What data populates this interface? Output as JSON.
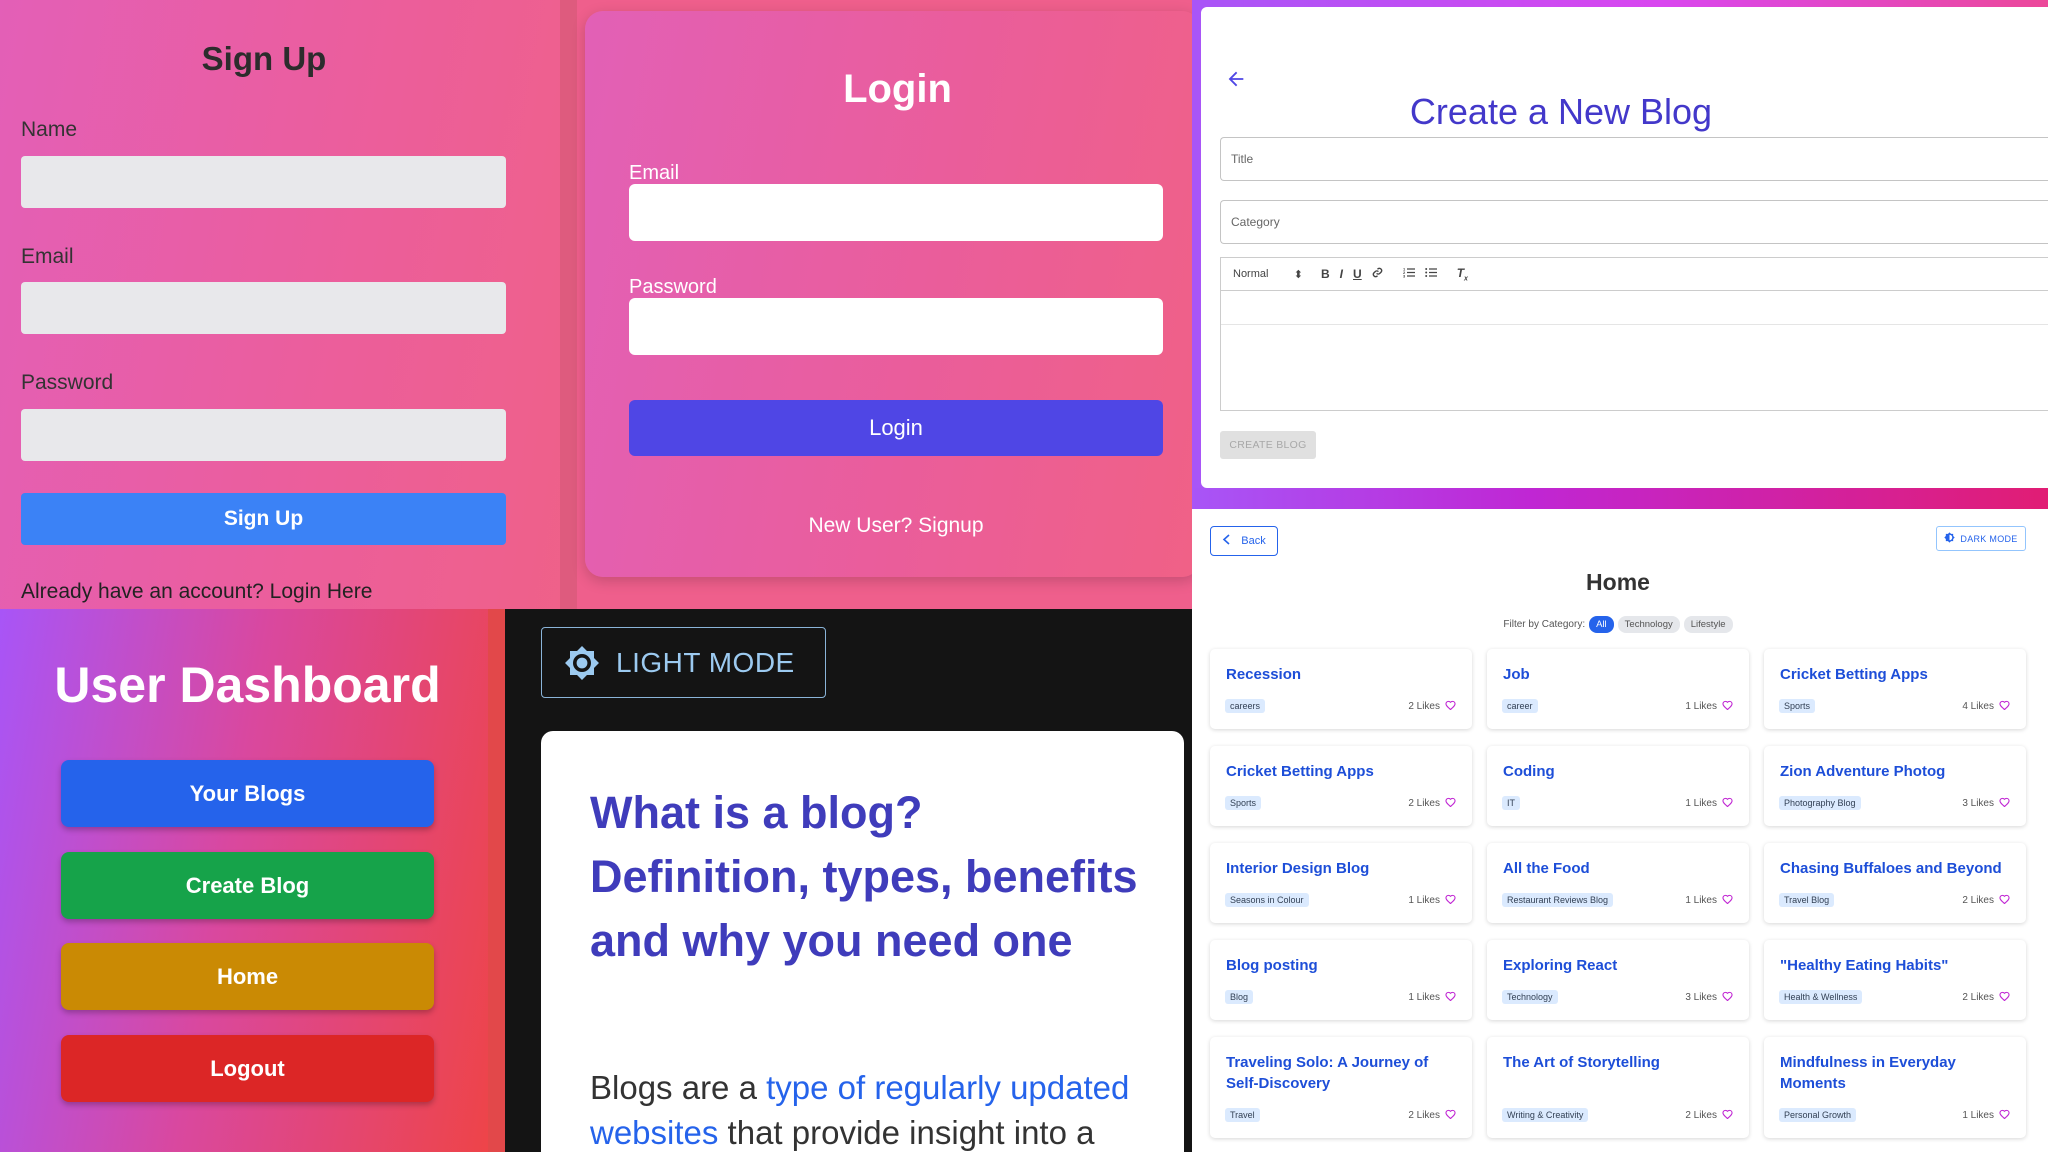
{
  "signup": {
    "title": "Sign Up",
    "name_label": "Name",
    "email_label": "Email",
    "password_label": "Password",
    "button": "Sign Up",
    "footer": "Already have an account? Login Here"
  },
  "login": {
    "title": "Login",
    "email_label": "Email",
    "password_label": "Password",
    "button": "Login",
    "footer": "New User? Signup"
  },
  "create_blog": {
    "title": "Create a New Blog",
    "title_placeholder": "Title",
    "category_placeholder": "Category",
    "format_select": "Normal",
    "button": "CREATE BLOG",
    "colors": {
      "heading": "#4338ca",
      "back": "#4f46e5"
    }
  },
  "dashboard": {
    "title": "User Dashboard",
    "buttons": [
      {
        "label": "Your Blogs",
        "color": "#2563eb"
      },
      {
        "label": "Create Blog",
        "color": "#16a34a"
      },
      {
        "label": "Home",
        "color": "#ca8a04"
      },
      {
        "label": "Logout",
        "color": "#dc2626"
      }
    ]
  },
  "article": {
    "mode_button": "LIGHT MODE",
    "heading": "What is a blog? Definition, types, benefits and why you need one",
    "body_start": "Blogs are a ",
    "body_link": "type of regularly updated websites",
    "body_end": " that provide insight into a"
  },
  "home": {
    "back": "Back",
    "dark_mode": "DARK MODE",
    "title": "Home",
    "filter_label": "Filter by Category:",
    "filters": [
      "All",
      "Technology",
      "Lifestyle"
    ],
    "active_filter": "All",
    "blogs": [
      {
        "title": "Recession",
        "category": "careers",
        "likes": "2 Likes"
      },
      {
        "title": "Job",
        "category": "career",
        "likes": "1 Likes"
      },
      {
        "title": "Cricket Betting Apps",
        "category": "Sports",
        "likes": "4 Likes"
      },
      {
        "title": "Cricket Betting Apps",
        "category": "Sports",
        "likes": "2 Likes"
      },
      {
        "title": "Coding",
        "category": "IT",
        "likes": "1 Likes"
      },
      {
        "title": "Zion Adventure Photog",
        "category": "Photography Blog",
        "likes": "3 Likes"
      },
      {
        "title": "Interior Design Blog",
        "category": "Seasons in Colour",
        "likes": "1 Likes"
      },
      {
        "title": "All the Food",
        "category": "Restaurant Reviews Blog",
        "likes": "1 Likes"
      },
      {
        "title": "Chasing Buffaloes and Beyond",
        "category": "Travel Blog",
        "likes": "2 Likes"
      },
      {
        "title": "Blog posting",
        "category": "Blog",
        "likes": "1 Likes"
      },
      {
        "title": "Exploring React",
        "category": "Technology",
        "likes": "3 Likes"
      },
      {
        "title": "\"Healthy Eating Habits\"",
        "category": "Health & Wellness",
        "likes": "2 Likes"
      },
      {
        "title": "Traveling Solo: A Journey of Self-Discovery",
        "category": "Travel",
        "likes": "2 Likes"
      },
      {
        "title": "The Art of Storytelling",
        "category": "Writing & Creativity",
        "likes": "2 Likes"
      },
      {
        "title": "Mindfulness in Everyday Moments",
        "category": "Personal Growth",
        "likes": "1 Likes"
      }
    ]
  }
}
